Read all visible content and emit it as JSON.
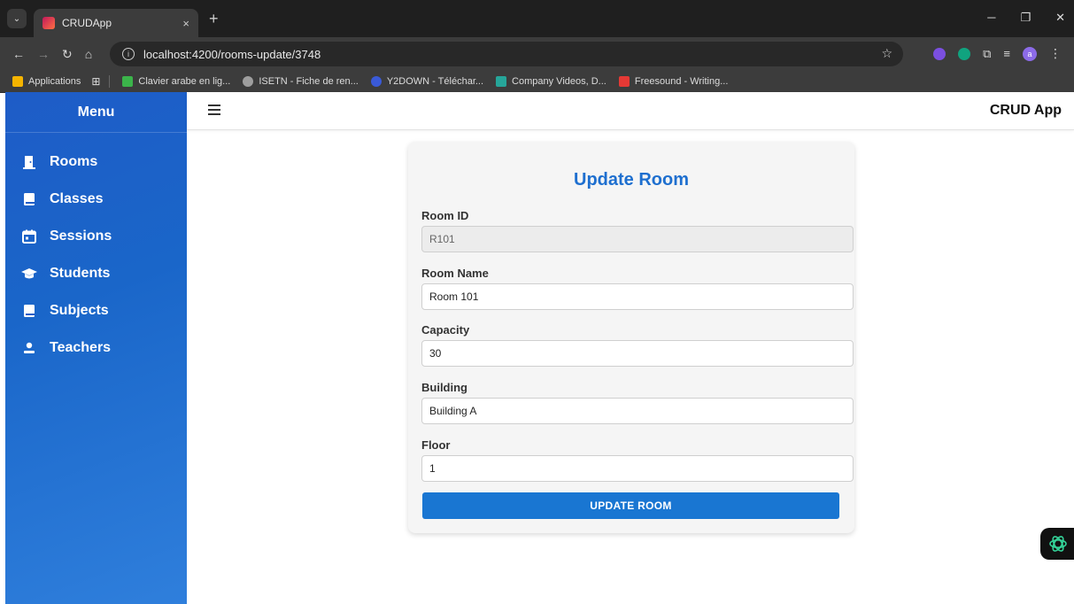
{
  "browser": {
    "tab_title": "CRUDApp",
    "tab_close": "×",
    "new_tab": "+",
    "url": "localhost:4200/rooms-update/3748",
    "bookmarks": [
      {
        "label": "Applications",
        "color": "#f5b400"
      },
      {
        "label": "Clavier arabe en lig...",
        "color": "#3bb44a"
      },
      {
        "label": "ISETN - Fiche de ren...",
        "color": "#9e9e9e"
      },
      {
        "label": "Y2DOWN - Téléchar...",
        "color": "#3a5ad8"
      },
      {
        "label": "Company Videos, D...",
        "color": "#26a69a"
      },
      {
        "label": "Freesound - Writing...",
        "color": "#e53935"
      }
    ]
  },
  "sidebar": {
    "title": "Menu",
    "items": [
      {
        "label": "Rooms",
        "icon": "door-icon"
      },
      {
        "label": "Classes",
        "icon": "book-icon"
      },
      {
        "label": "Sessions",
        "icon": "calendar-icon"
      },
      {
        "label": "Students",
        "icon": "graduation-cap-icon"
      },
      {
        "label": "Subjects",
        "icon": "book-icon"
      },
      {
        "label": "Teachers",
        "icon": "user-icon"
      }
    ]
  },
  "header": {
    "app_title": "CRUD App"
  },
  "form": {
    "title": "Update Room",
    "fields": [
      {
        "label": "Room ID",
        "value": "R101"
      },
      {
        "label": "Room Name",
        "value": "Room 101"
      },
      {
        "label": "Capacity",
        "value": "30"
      },
      {
        "label": "Building",
        "value": "Building A"
      },
      {
        "label": "Floor",
        "value": "1"
      }
    ],
    "submit_label": "UPDATE ROOM"
  },
  "colors": {
    "primary": "#1976d2",
    "title": "#1e6fcf",
    "sidebar_start": "#1e5cc7",
    "sidebar_end": "#2f7fdc"
  }
}
